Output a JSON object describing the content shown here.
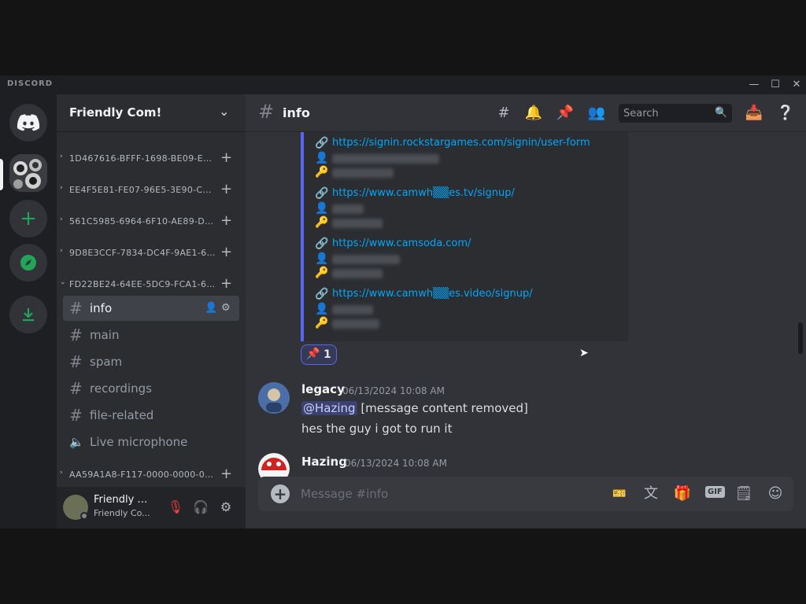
{
  "window": {
    "brand": "DISCORD",
    "controls": {
      "minimize": "—",
      "maximize": "☐",
      "close": "✕"
    }
  },
  "server": {
    "name": "Friendly Com!",
    "categories": [
      "1D467616-BFFF-1698-BE09-E89...",
      "EE4F5E81-FE07-96E5-3E90-C87...",
      "561C5985-6964-6F10-AE89-D84...",
      "9D8E3CCF-7834-DC4F-9AE1-60...",
      "FD22BE24-64EE-5DC9-FCA1-66...",
      "AA59A1A8-F117-0000-0000-00..."
    ],
    "channels": [
      {
        "name": "info",
        "type": "text"
      },
      {
        "name": "main",
        "type": "text"
      },
      {
        "name": "spam",
        "type": "text"
      },
      {
        "name": "recordings",
        "type": "text"
      },
      {
        "name": "file-related",
        "type": "text"
      },
      {
        "name": "Live microphone",
        "type": "voice"
      }
    ]
  },
  "user": {
    "name": "Friendly C...",
    "status": "Friendly Co..."
  },
  "channel_header": {
    "name": "info",
    "search_placeholder": "Search"
  },
  "embed": {
    "links": [
      "https://signin.rockstargames.com/signin/user-form",
      "https://www.camwh▒▒es.tv/signup/",
      "https://www.camsoda.com/",
      "https://www.camwh▒▒es.video/signup/"
    ]
  },
  "reaction": {
    "emoji": "📌",
    "count": "1"
  },
  "messages": [
    {
      "author": "legacy",
      "timestamp": "06/13/2024 10:08 AM",
      "mention": "@Hazing",
      "line1": "[message content removed]",
      "line2": "hes the guy i got to run it"
    },
    {
      "author": "Hazing",
      "timestamp": "06/13/2024 10:08 AM"
    }
  ],
  "composer": {
    "placeholder": "Message #info"
  },
  "colors": {
    "accent": "#5865f2",
    "link": "#00a8fc",
    "background": "#313338",
    "sidebar": "#2b2d31",
    "rail": "#1e1f22",
    "discord_green": "#23a559"
  }
}
